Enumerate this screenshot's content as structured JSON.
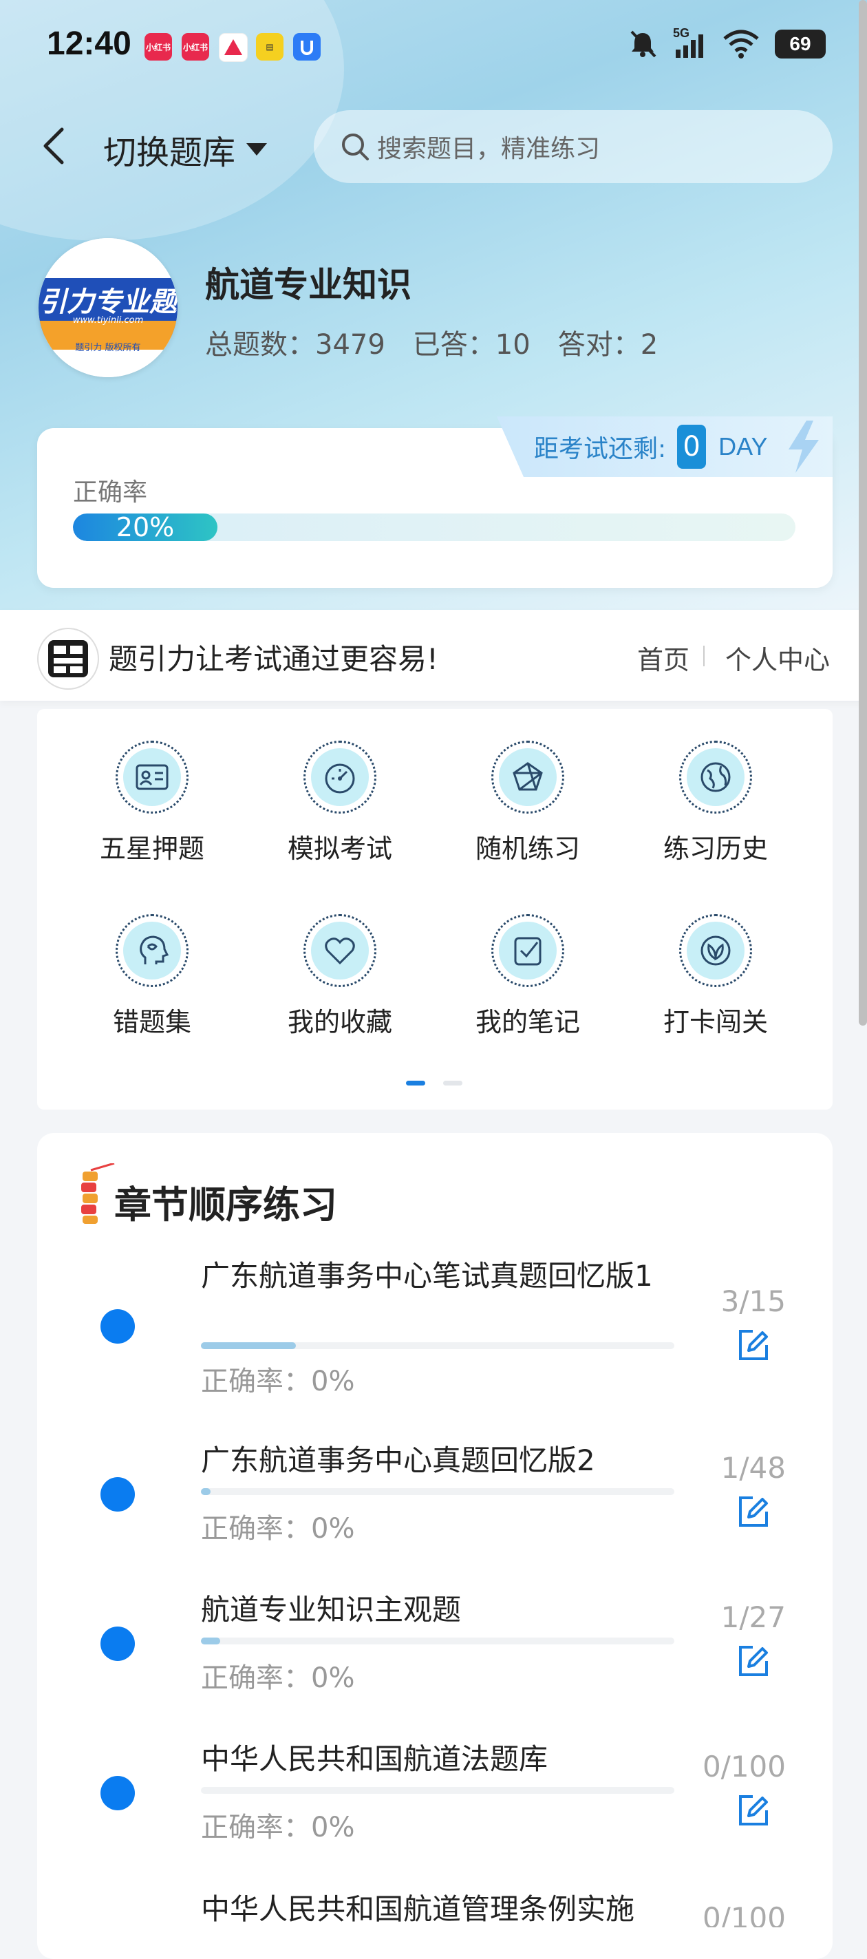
{
  "status_bar": {
    "time": "12:40",
    "network": "5G",
    "battery": "69",
    "apps": [
      {
        "label": "小红书",
        "color": "#e8294d"
      },
      {
        "label": "小红书",
        "color": "#e8294d"
      },
      {
        "label": "",
        "color": "#ffffff"
      },
      {
        "label": "",
        "color": "#f5d020"
      },
      {
        "label": "",
        "color": "#2d7cf6"
      }
    ]
  },
  "header": {
    "switch_label": "切换题库",
    "search_placeholder": "搜索题目，精准练习"
  },
  "bank": {
    "title": "航道专业知识",
    "logo_text": "引力专业题",
    "logo_url": "www.tiyinli.com",
    "logo_sub": "题引力 版权所有",
    "total_label": "总题数：3479",
    "answered_label": "已答：10",
    "correct_label": "答对：2"
  },
  "accuracy": {
    "countdown_label": "距考试还剩:",
    "countdown_value": "0",
    "countdown_unit": "DAY",
    "label": "正确率",
    "value_text": "20%",
    "value": 0.2
  },
  "slogan": {
    "text": "题引力让考试通过更容易!",
    "nav_home": "首页",
    "nav_me": "个人中心"
  },
  "features": [
    {
      "label": "五星押题",
      "icon": "id-card-icon"
    },
    {
      "label": "模拟考试",
      "icon": "speedometer-icon"
    },
    {
      "label": "随机练习",
      "icon": "network-icon"
    },
    {
      "label": "练习历史",
      "icon": "globe-icon"
    },
    {
      "label": "错题集",
      "icon": "head-icon"
    },
    {
      "label": "我的收藏",
      "icon": "heart-icon"
    },
    {
      "label": "我的笔记",
      "icon": "note-check-icon"
    },
    {
      "label": "打卡闯关",
      "icon": "leaf-icon"
    }
  ],
  "chapters": {
    "title": "章节顺序练习",
    "items": [
      {
        "name": "广东航道事务中心笔试真题回忆版1",
        "accuracy": "正确率：0%",
        "count": "3/15",
        "progress": 0.2
      },
      {
        "name": "广东航道事务中心真题回忆版2",
        "accuracy": "正确率：0%",
        "count": "1/48",
        "progress": 0.02
      },
      {
        "name": "航道专业知识主观题",
        "accuracy": "正确率：0%",
        "count": "1/27",
        "progress": 0.04
      },
      {
        "name": "中华人民共和国航道法题库",
        "accuracy": "正确率：0%",
        "count": "0/100",
        "progress": 0
      },
      {
        "name": "中华人民共和国航道管理条例实施",
        "accuracy": "",
        "count": "0/100",
        "progress": 0
      }
    ]
  }
}
